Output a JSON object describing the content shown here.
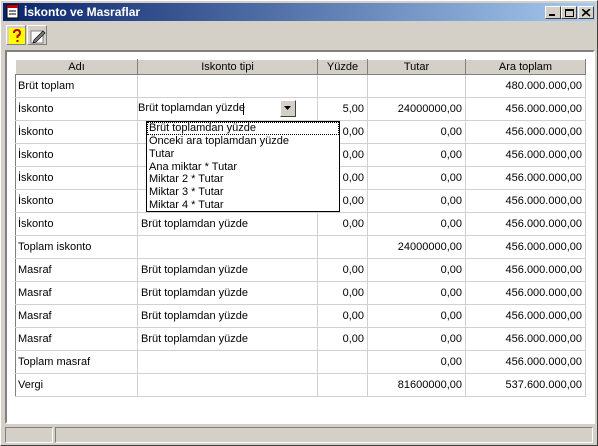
{
  "window": {
    "title": "İskonto ve Masraflar"
  },
  "toolbar": {
    "help_icon": "question-mark-icon",
    "edit_icon": "pencil-icon"
  },
  "columns": [
    "Adı",
    "Iskonto tipi",
    "Yüzde",
    "Tutar",
    "Ara toplam"
  ],
  "rows": [
    {
      "name": "Brüt toplam",
      "type": "",
      "percent": "",
      "amount": "",
      "subtotal": "480.000.000,00"
    },
    {
      "name": "İskonto",
      "type": "Brüt toplamdan yüzde",
      "percent": "5,00",
      "amount": "24000000,00",
      "subtotal": "456.000.000,00"
    },
    {
      "name": "İskonto",
      "type": "",
      "percent": "0,00",
      "amount": "0,00",
      "subtotal": "456.000.000,00"
    },
    {
      "name": "İskonto",
      "type": "",
      "percent": "0,00",
      "amount": "0,00",
      "subtotal": "456.000.000,00"
    },
    {
      "name": "İskonto",
      "type": "",
      "percent": "0,00",
      "amount": "0,00",
      "subtotal": "456.000.000,00"
    },
    {
      "name": "İskonto",
      "type": "",
      "percent": "0,00",
      "amount": "0,00",
      "subtotal": "456.000.000,00"
    },
    {
      "name": "İskonto",
      "type": "Brüt toplamdan yüzde",
      "percent": "0,00",
      "amount": "0,00",
      "subtotal": "456.000.000,00"
    },
    {
      "name": "Toplam iskonto",
      "type": "",
      "percent": "",
      "amount": "24000000,00",
      "subtotal": "456.000.000,00"
    },
    {
      "name": "Masraf",
      "type": "Brüt toplamdan yüzde",
      "percent": "0,00",
      "amount": "0,00",
      "subtotal": "456.000.000,00"
    },
    {
      "name": "Masraf",
      "type": "Brüt toplamdan yüzde",
      "percent": "0,00",
      "amount": "0,00",
      "subtotal": "456.000.000,00"
    },
    {
      "name": "Masraf",
      "type": "Brüt toplamdan yüzde",
      "percent": "0,00",
      "amount": "0,00",
      "subtotal": "456.000.000,00"
    },
    {
      "name": "Masraf",
      "type": "Brüt toplamdan yüzde",
      "percent": "0,00",
      "amount": "0,00",
      "subtotal": "456.000.000,00"
    },
    {
      "name": "Toplam masraf",
      "type": "",
      "percent": "",
      "amount": "0,00",
      "subtotal": "456.000.000,00"
    },
    {
      "name": "Vergi",
      "type": "",
      "percent": "",
      "amount": "81600000,00",
      "subtotal": "537.600.000,00"
    }
  ],
  "dropdown": {
    "options": [
      "Brüt toplamdan yüzde",
      "Önceki ara toplamdan yüzde",
      "Tutar",
      "Ana miktar * Tutar",
      "Miktar 2 * Tutar",
      "Miktar 3 * Tutar",
      "Miktar 4 * Tutar"
    ]
  },
  "colors": {
    "title_start": "#0a246a",
    "title_end": "#a6caf0",
    "face": "#d4d0c8"
  }
}
